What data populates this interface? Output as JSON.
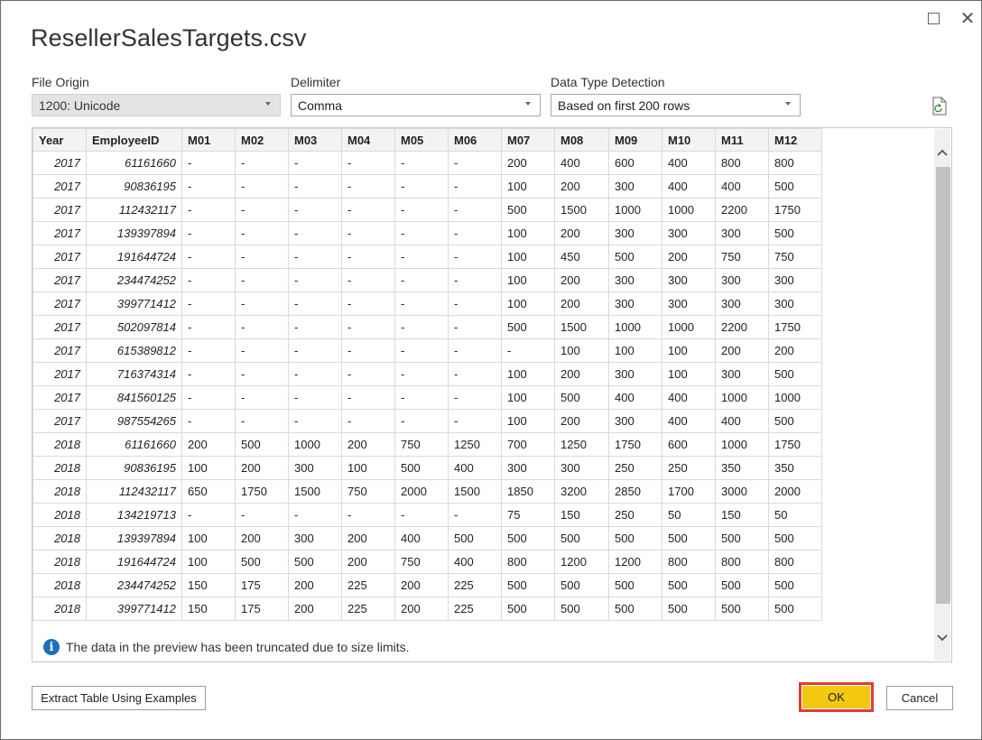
{
  "window": {
    "title": "ResellerSalesTargets.csv",
    "maximize_icon": "maximize-icon",
    "close_icon": "close-icon",
    "close_glyph": "✕"
  },
  "options": {
    "file_origin": {
      "label": "File Origin",
      "value": "1200: Unicode"
    },
    "delimiter": {
      "label": "Delimiter",
      "value": "Comma"
    },
    "data_type_detection": {
      "label": "Data Type Detection",
      "value": "Based on first 200 rows"
    },
    "refresh_icon": "refresh-document-icon"
  },
  "table": {
    "columns": [
      "Year",
      "EmployeeID",
      "M01",
      "M02",
      "M03",
      "M04",
      "M05",
      "M06",
      "M07",
      "M08",
      "M09",
      "M10",
      "M11",
      "M12"
    ],
    "rows": [
      [
        "2017",
        "61161660",
        "-",
        "-",
        "-",
        "-",
        "-",
        "-",
        "200",
        "400",
        "600",
        "400",
        "800",
        "800"
      ],
      [
        "2017",
        "90836195",
        "-",
        "-",
        "-",
        "-",
        "-",
        "-",
        "100",
        "200",
        "300",
        "400",
        "400",
        "500"
      ],
      [
        "2017",
        "112432117",
        "-",
        "-",
        "-",
        "-",
        "-",
        "-",
        "500",
        "1500",
        "1000",
        "1000",
        "2200",
        "1750"
      ],
      [
        "2017",
        "139397894",
        "-",
        "-",
        "-",
        "-",
        "-",
        "-",
        "100",
        "200",
        "300",
        "300",
        "300",
        "500"
      ],
      [
        "2017",
        "191644724",
        "-",
        "-",
        "-",
        "-",
        "-",
        "-",
        "100",
        "450",
        "500",
        "200",
        "750",
        "750"
      ],
      [
        "2017",
        "234474252",
        "-",
        "-",
        "-",
        "-",
        "-",
        "-",
        "100",
        "200",
        "300",
        "300",
        "300",
        "300"
      ],
      [
        "2017",
        "399771412",
        "-",
        "-",
        "-",
        "-",
        "-",
        "-",
        "100",
        "200",
        "300",
        "300",
        "300",
        "300"
      ],
      [
        "2017",
        "502097814",
        "-",
        "-",
        "-",
        "-",
        "-",
        "-",
        "500",
        "1500",
        "1000",
        "1000",
        "2200",
        "1750"
      ],
      [
        "2017",
        "615389812",
        "-",
        "-",
        "-",
        "-",
        "-",
        "-",
        "-",
        "100",
        "100",
        "100",
        "200",
        "200"
      ],
      [
        "2017",
        "716374314",
        "-",
        "-",
        "-",
        "-",
        "-",
        "-",
        "100",
        "200",
        "300",
        "100",
        "300",
        "500"
      ],
      [
        "2017",
        "841560125",
        "-",
        "-",
        "-",
        "-",
        "-",
        "-",
        "100",
        "500",
        "400",
        "400",
        "1000",
        "1000"
      ],
      [
        "2017",
        "987554265",
        "-",
        "-",
        "-",
        "-",
        "-",
        "-",
        "100",
        "200",
        "300",
        "400",
        "400",
        "500"
      ],
      [
        "2018",
        "61161660",
        "200",
        "500",
        "1000",
        "200",
        "750",
        "1250",
        "700",
        "1250",
        "1750",
        "600",
        "1000",
        "1750"
      ],
      [
        "2018",
        "90836195",
        "100",
        "200",
        "300",
        "100",
        "500",
        "400",
        "300",
        "300",
        "250",
        "250",
        "350",
        "350"
      ],
      [
        "2018",
        "112432117",
        "650",
        "1750",
        "1500",
        "750",
        "2000",
        "1500",
        "1850",
        "3200",
        "2850",
        "1700",
        "3000",
        "2000"
      ],
      [
        "2018",
        "134219713",
        "-",
        "-",
        "-",
        "-",
        "-",
        "-",
        "75",
        "150",
        "250",
        "50",
        "150",
        "50"
      ],
      [
        "2018",
        "139397894",
        "100",
        "200",
        "300",
        "200",
        "400",
        "500",
        "500",
        "500",
        "500",
        "500",
        "500",
        "500"
      ],
      [
        "2018",
        "191644724",
        "100",
        "500",
        "500",
        "200",
        "750",
        "400",
        "800",
        "1200",
        "1200",
        "800",
        "800",
        "800"
      ],
      [
        "2018",
        "234474252",
        "150",
        "175",
        "200",
        "225",
        "200",
        "225",
        "500",
        "500",
        "500",
        "500",
        "500",
        "500"
      ],
      [
        "2018",
        "399771412",
        "150",
        "175",
        "200",
        "225",
        "200",
        "225",
        "500",
        "500",
        "500",
        "500",
        "500",
        "500"
      ]
    ]
  },
  "notice": {
    "icon": "info-icon",
    "glyph": "i",
    "text": "The data in the preview has been truncated due to size limits."
  },
  "buttons": {
    "extract": "Extract Table Using Examples",
    "ok": "OK",
    "cancel": "Cancel"
  },
  "colors": {
    "ok_button": "#f2c811",
    "highlight_border": "#e53935",
    "info_icon": "#1d6fbd"
  }
}
